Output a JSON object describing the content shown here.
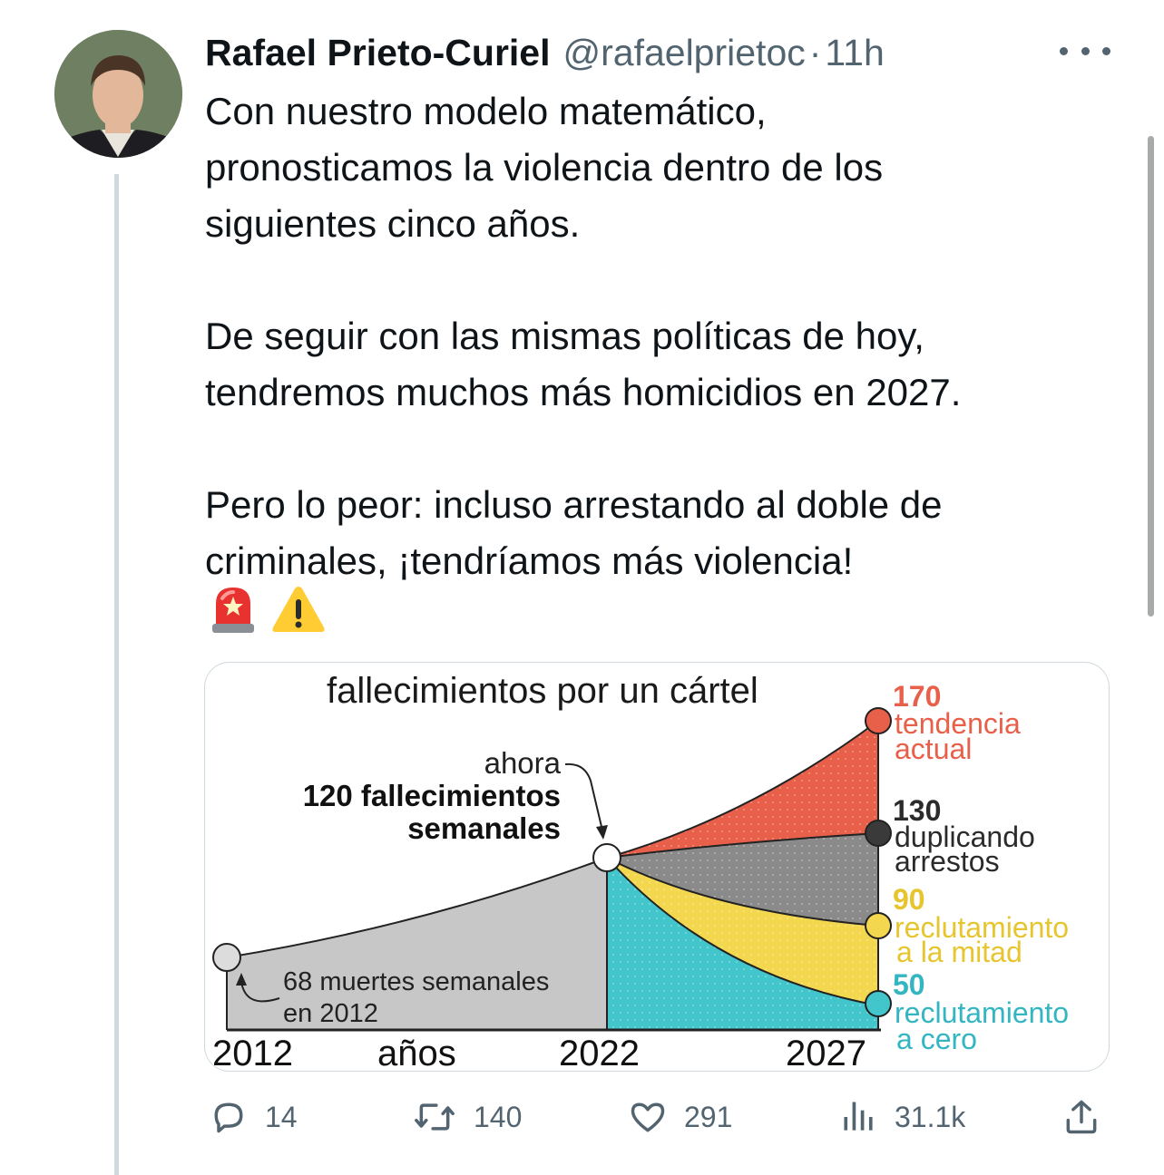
{
  "author": {
    "name": "Rafael Prieto-Curiel",
    "handle": "@rafaelprietoc",
    "separator": "·",
    "time": "11h"
  },
  "tweet": {
    "paragraphs": [
      [
        "Con nuestro modelo matemático,",
        "pronosticamos la violencia dentro de los",
        "siguientes cinco años."
      ],
      [
        "De seguir con las mismas políticas de hoy,",
        "tendremos muchos más homicidios en 2027."
      ],
      [
        "Pero lo peor: incluso arrestando al doble de",
        "criminales, ¡tendríamos más violencia!"
      ]
    ],
    "emojis": [
      "rotating-light-emoji",
      "warning-emoji"
    ]
  },
  "figure": {
    "title": "fallecimientos por un cártel",
    "now_label": "ahora",
    "now_value_line1": "120 fallecimientos",
    "now_value_line2": "semanales",
    "start_label_line1": "68 muertes semanales",
    "start_label_line2": "en 2012",
    "x_axis_label": "años",
    "x_ticks": [
      "2012",
      "2022",
      "2027"
    ],
    "scenarios": [
      {
        "value": "170",
        "label_line1": "tendencia",
        "label_line2": "actual",
        "color": "#e8604a"
      },
      {
        "value": "130",
        "label_line1": "duplicando",
        "label_line2": "arrestos",
        "color": "#3a3a3a"
      },
      {
        "value": "90",
        "label_line1": "reclutamiento",
        "label_line2": "a la mitad",
        "color": "#e8c93a"
      },
      {
        "value": "50",
        "label_line1": "reclutamiento",
        "label_line2": "a cero",
        "color": "#3ab8c4"
      }
    ]
  },
  "actions": {
    "replies": "14",
    "retweets": "140",
    "likes": "291",
    "views": "31.1k"
  },
  "icons": [
    "more-icon",
    "reply-icon",
    "retweet-icon",
    "like-icon",
    "views-icon",
    "share-icon"
  ],
  "colors": {
    "text": "#0f1419",
    "secondary": "#536471",
    "border": "#cfd9de"
  }
}
